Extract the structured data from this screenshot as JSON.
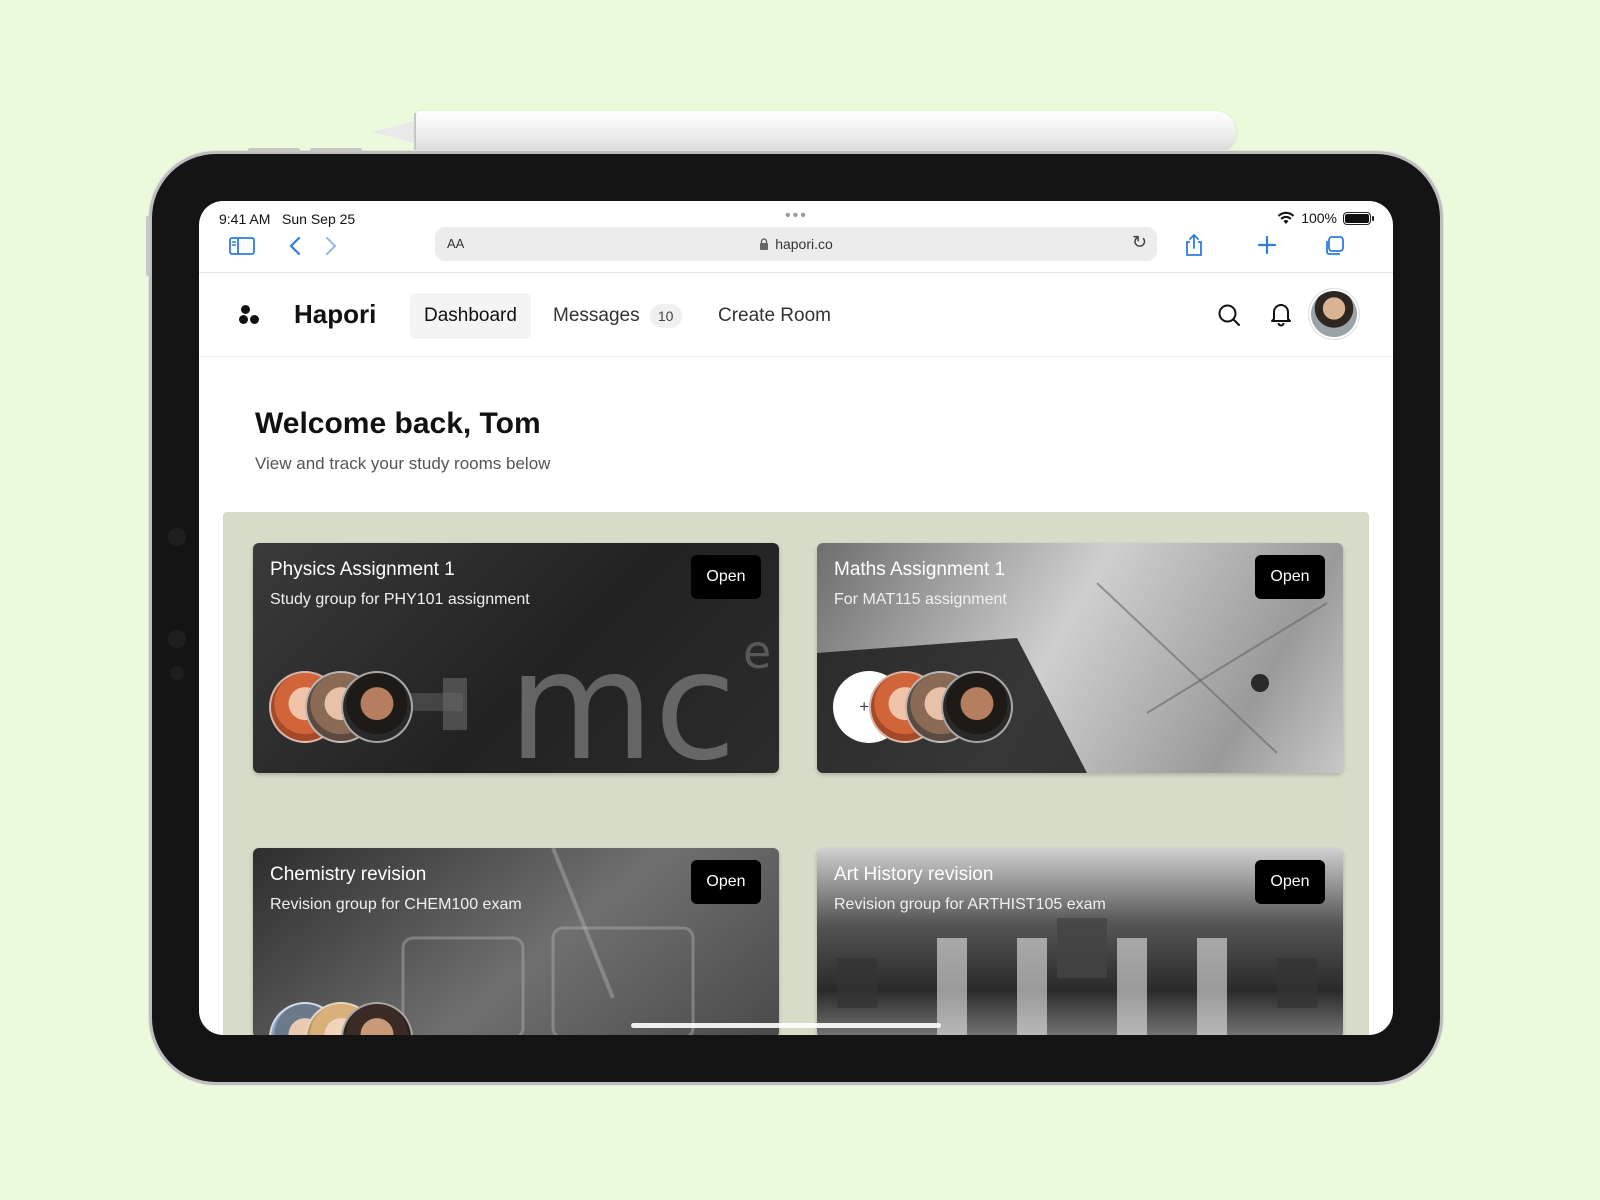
{
  "status_bar": {
    "time": "9:41 AM",
    "date": "Sun Sep 25",
    "battery": "100%"
  },
  "browser": {
    "text_size": "AA",
    "url": "hapori.co"
  },
  "app": {
    "brand": "Hapori",
    "nav": {
      "dashboard": "Dashboard",
      "messages": "Messages",
      "messages_count": "10",
      "create_room": "Create Room"
    }
  },
  "welcome": {
    "title": "Welcome back, Tom",
    "subtitle": "View and track your study rooms below"
  },
  "rooms": [
    {
      "title": "Physics Assignment 1",
      "description": "Study group for PHY101 assignment",
      "button": "Open"
    },
    {
      "title": "Maths Assignment 1",
      "description": "For MAT115 assignment",
      "button": "Open",
      "extra_members": "+3"
    },
    {
      "title": "Chemistry revision",
      "description": "Revision group for CHEM100 exam",
      "button": "Open"
    },
    {
      "title": "Art History revision",
      "description": "Revision group for ARTHIST105 exam",
      "button": "Open"
    }
  ],
  "colors": {
    "page_bg": "#ecfadc",
    "panel_bg": "#d6dcc8",
    "accent_blue": "#2f7be0",
    "button_bg": "#000000"
  }
}
